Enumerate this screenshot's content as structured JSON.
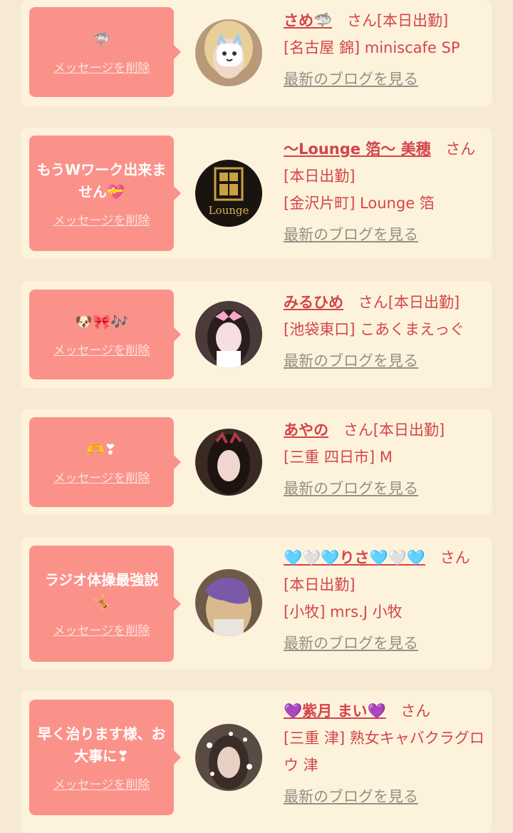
{
  "cards": [
    {
      "message": "🦈",
      "delete_label": "メッセージを削除",
      "name": "さめ🦈",
      "san": "さん",
      "status": "[本日出勤]",
      "shop": "[名古屋 錦] miniscafe SP",
      "blog": "最新のブログを見る",
      "avatar": "girl-selfie-with-sticker"
    },
    {
      "message": "もうWワーク出来ません💝",
      "delete_label": "メッセージを削除",
      "name": "〜Lounge 箔〜 美穂",
      "san": "さん",
      "status": "[本日出勤]",
      "shop": "[金沢片町] Lounge 箔",
      "blog": "最新のブログを見る",
      "avatar": "lounge-logo"
    },
    {
      "message": "🐶🎀🎶",
      "delete_label": "メッセージを削除",
      "name": "みるひめ",
      "san": "さん",
      "status": "[本日出勤]",
      "shop": "[池袋東口] こあくまえっぐ",
      "blog": "最新のブログを見る",
      "avatar": "girl-with-bow"
    },
    {
      "message": "🫶❣",
      "delete_label": "メッセージを削除",
      "name": "あやの",
      "san": "さん",
      "status": "[本日出勤]",
      "shop": "[三重 四日市] M",
      "blog": "最新のブログを見る",
      "avatar": "girl-portrait"
    },
    {
      "message": "ラジオ体操最強説🤸",
      "delete_label": "メッセージを削除",
      "name": "🩵🤍🩵りさ🩵🤍🩵",
      "san": "さん",
      "status": "[本日出勤]",
      "shop": "[小牧] mrs.J 小牧",
      "blog": "最新のブログを見る",
      "avatar": "girl-with-sticker-purple"
    },
    {
      "message": "早く治ります様、お大事に❣",
      "delete_label": "メッセージを削除",
      "name": "💜紫月 まい💜",
      "san": "さん",
      "status": "",
      "shop": "[三重 津] 熟女キャバクラグロウ 津",
      "blog": "最新のブログを見る",
      "avatar": "woman-sparkle"
    }
  ],
  "colors": {
    "background": "#f7ead5",
    "card": "#fdf3dd",
    "bubble": "#fb928a",
    "accent": "#d4444a",
    "link_gray": "#9a8c85"
  }
}
